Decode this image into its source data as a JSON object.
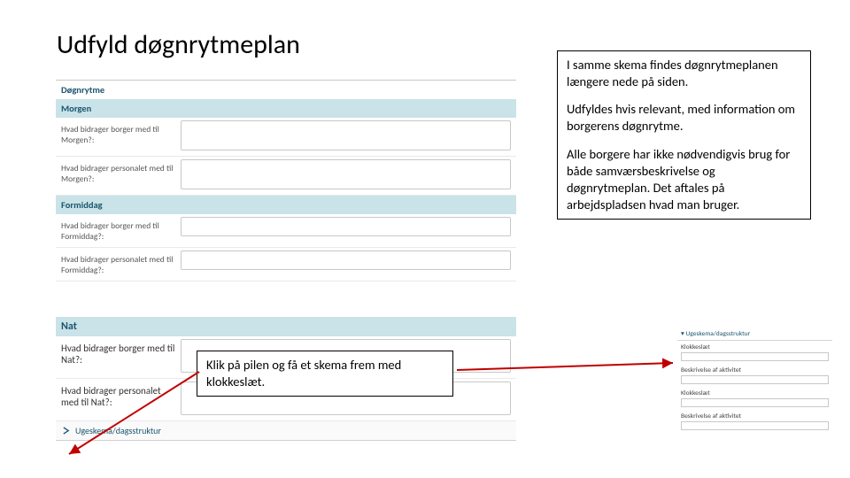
{
  "title": "Udfyld døgnrytmeplan",
  "info": {
    "p1": "I samme skema findes døgnrytmeplanen længere nede på siden.",
    "p2": "Udfyldes hvis relevant, med information om borgerens døgnrytme.",
    "p3": "Alle borgere har ikke nødvendigvis brug for både samværsbeskrivelse og døgnrytmeplan. Det aftales på arbejdspladsen hvad man bruger."
  },
  "tip": "Klik på pilen og få et skema frem med klokkeslæt.",
  "form": {
    "section_main": "Døgnrytme",
    "section_morning": "Morgen",
    "q1": "Hvad bidrager borger med til Morgen?:",
    "q2": "Hvad bidrager personalet med til Morgen?:",
    "section_forenoon": "Formiddag",
    "q3": "Hvad bidrager borger med til Formiddag?:",
    "q4": "Hvad bidrager personalet med til Formiddag?:",
    "section_night": "Nat",
    "q5": "Hvad bidrager borger med til Nat?:",
    "q6": "Hvad bidrager personalet med til Nat?:",
    "expander": "Ugeskema/dagsstruktur",
    "side_header": "Ugeskema/dagsstruktur",
    "side_lbl1": "Klokkeslæt",
    "side_lbl2": "Beskrivelse af aktivitet",
    "side_lbl3": "Klokkeslæt",
    "side_lbl4": "Beskrivelse af aktivitet"
  }
}
